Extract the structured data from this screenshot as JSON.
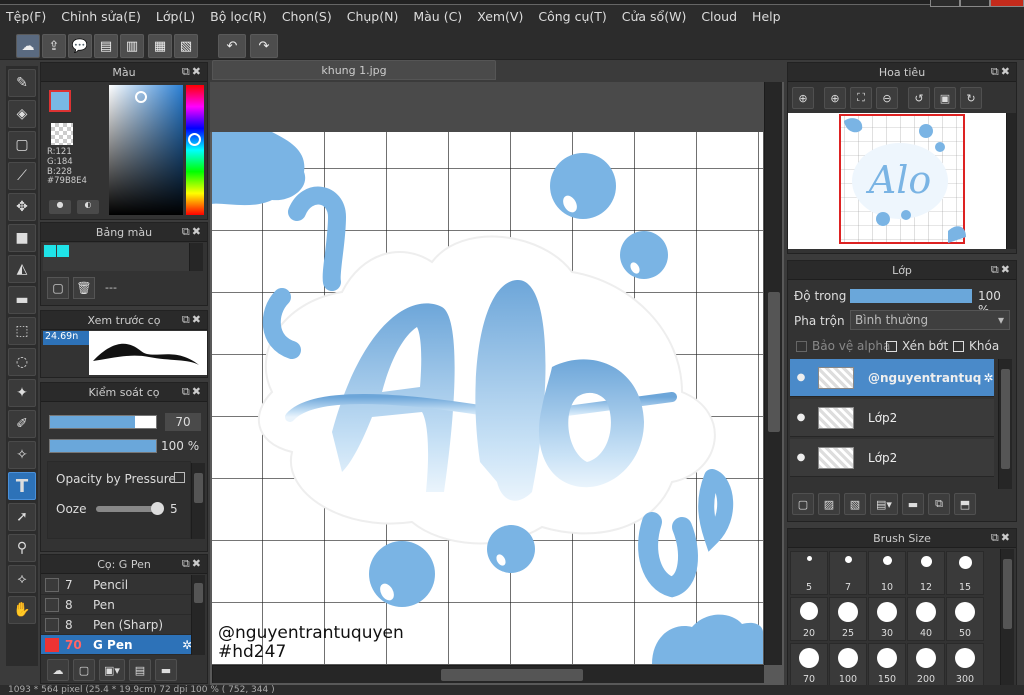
{
  "menu": [
    "Tệp(F)",
    "Chỉnh sửa(E)",
    "Lớp(L)",
    "Bộ lọc(R)",
    "Chọn(S)",
    "Chụp(N)",
    "Màu (C)",
    "Xem(V)",
    "Công cụ(T)",
    "Cửa sổ(W)",
    "Cloud",
    "Help"
  ],
  "canvas_tab": "khung 1.jpg",
  "color_panel": {
    "title": "Màu",
    "r": "R:121",
    "g": "G:184",
    "b": "B:228",
    "hex": "#79B8E4",
    "fg": "#79B8E4"
  },
  "palette_panel": {
    "title": "Bảng màu",
    "dash": "---"
  },
  "brush_preview": {
    "title": "Xem trước cọ",
    "size": "24.69n"
  },
  "brush_control": {
    "title": "Kiểm soát cọ",
    "size_val": "70",
    "opacity_val": "100 %",
    "opacity_by_pressure": "Opacity by Pressure",
    "ooze_label": "Ooze",
    "ooze_val": "5",
    "size_fill": 0.8,
    "opacity_fill": 1.0,
    "ooze_fill": 1.0
  },
  "brush_list": {
    "title": "Cọ: G Pen",
    "items": [
      {
        "num": "7",
        "name": "Pencil"
      },
      {
        "num": "8",
        "name": "Pen"
      },
      {
        "num": "8",
        "name": "Pen (Sharp)"
      },
      {
        "num": "70",
        "name": "G Pen",
        "selected": true
      }
    ]
  },
  "navigator": {
    "title": "Hoa tiêu"
  },
  "layers": {
    "title": "Lớp",
    "opacity_label": "Độ trong",
    "opacity_val": "100 %",
    "opacity_fill": 1.0,
    "blend_label": "Pha trộn",
    "blend_val": "Bình thường",
    "protect_alpha": "Bảo vệ alpha",
    "clip": "Xén bớt",
    "lock": "Khóa",
    "items": [
      {
        "name": "@nguyentrantuq",
        "selected": true
      },
      {
        "name": "Lớp2"
      },
      {
        "name": "Lớp2"
      }
    ]
  },
  "brush_size": {
    "title": "Brush Size",
    "sizes": [
      "5",
      "7",
      "10",
      "12",
      "15",
      "20",
      "25",
      "30",
      "40",
      "50",
      "70",
      "100",
      "150",
      "200",
      "300"
    ]
  },
  "watermark": {
    "line1": "@nguyentrantuquyen",
    "line2": "#hd247"
  },
  "art": {
    "word": "Alo"
  },
  "status": "1093 * 564 pixel   (25.4 * 19.9cm)   72 dpi   100 %   ( 752, 344 )"
}
